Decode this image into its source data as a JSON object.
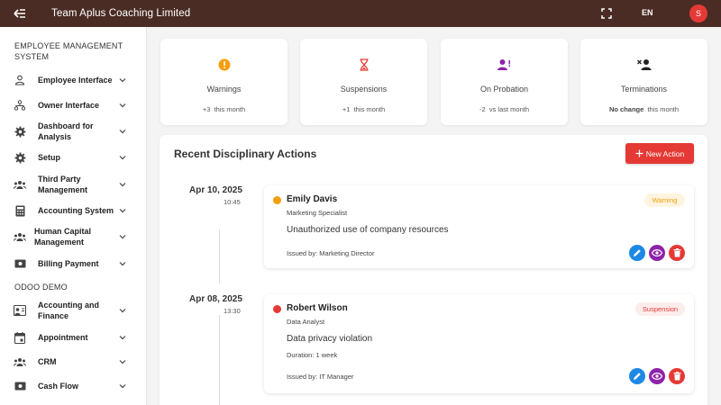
{
  "header": {
    "company": "Team Aplus Coaching Limited",
    "language": "EN",
    "avatar_initial": "S"
  },
  "sidebar": {
    "section1": "EMPLOYEE MANAGEMENT SYSTEM",
    "items1": [
      {
        "label": "Employee Interface",
        "icon": "person-icon"
      },
      {
        "label": "Owner Interface",
        "icon": "hierarchy-icon"
      },
      {
        "label": "Dashboard for Analysis",
        "icon": "gear-icon"
      },
      {
        "label": "Setup",
        "icon": "gear-icon"
      },
      {
        "label": "Third Party Management",
        "icon": "group-icon"
      },
      {
        "label": "Accounting System",
        "icon": "calculator-icon"
      },
      {
        "label": "Human Capital Management",
        "icon": "group-icon"
      },
      {
        "label": "Billing Payment",
        "icon": "payment-icon"
      }
    ],
    "section2": "ODOO DEMO",
    "items2": [
      {
        "label": "Accounting and Finance",
        "icon": "account-box-icon"
      },
      {
        "label": "Appointment",
        "icon": "calendar-icon"
      },
      {
        "label": "CRM",
        "icon": "group-icon"
      },
      {
        "label": "Cash Flow",
        "icon": "payment-icon"
      }
    ]
  },
  "stats": [
    {
      "label": "Warnings",
      "value": "+3",
      "period": "this month",
      "icon": "warning-icon",
      "color": "#f59e0b"
    },
    {
      "label": "Suspensions",
      "value": "+1",
      "period": "this month",
      "icon": "hourglass-icon",
      "color": "#e53935"
    },
    {
      "label": "On Probation",
      "value": "-2",
      "period": "vs last month",
      "icon": "person-probation-icon",
      "color": "#8e24aa"
    },
    {
      "label": "Terminations",
      "value": "No change",
      "period": "this month",
      "icon": "person-remove-icon",
      "color": "#222222"
    }
  ],
  "panel": {
    "title": "Recent Disciplinary Actions",
    "new_button": "New Action"
  },
  "actions": [
    {
      "date": "Apr 10, 2025",
      "time": "10:45",
      "name": "Emily Davis",
      "role": "Marketing Specialist",
      "badge": "Warning",
      "badge_color": "#f59e0b",
      "badge_bg": "#fff4e0",
      "dot_color": "#f59e0b",
      "reason": "Unauthorized use of company resources",
      "duration": "",
      "issued_by": "Issued by: Marketing Director"
    },
    {
      "date": "Apr 08, 2025",
      "time": "13:30",
      "name": "Robert Wilson",
      "role": "Data Analyst",
      "badge": "Suspension",
      "badge_color": "#e53935",
      "badge_bg": "#fdecec",
      "dot_color": "#e53935",
      "reason": "Data privacy violation",
      "duration": "Duration: 1 week",
      "issued_by": "Issued by: IT Manager"
    }
  ]
}
